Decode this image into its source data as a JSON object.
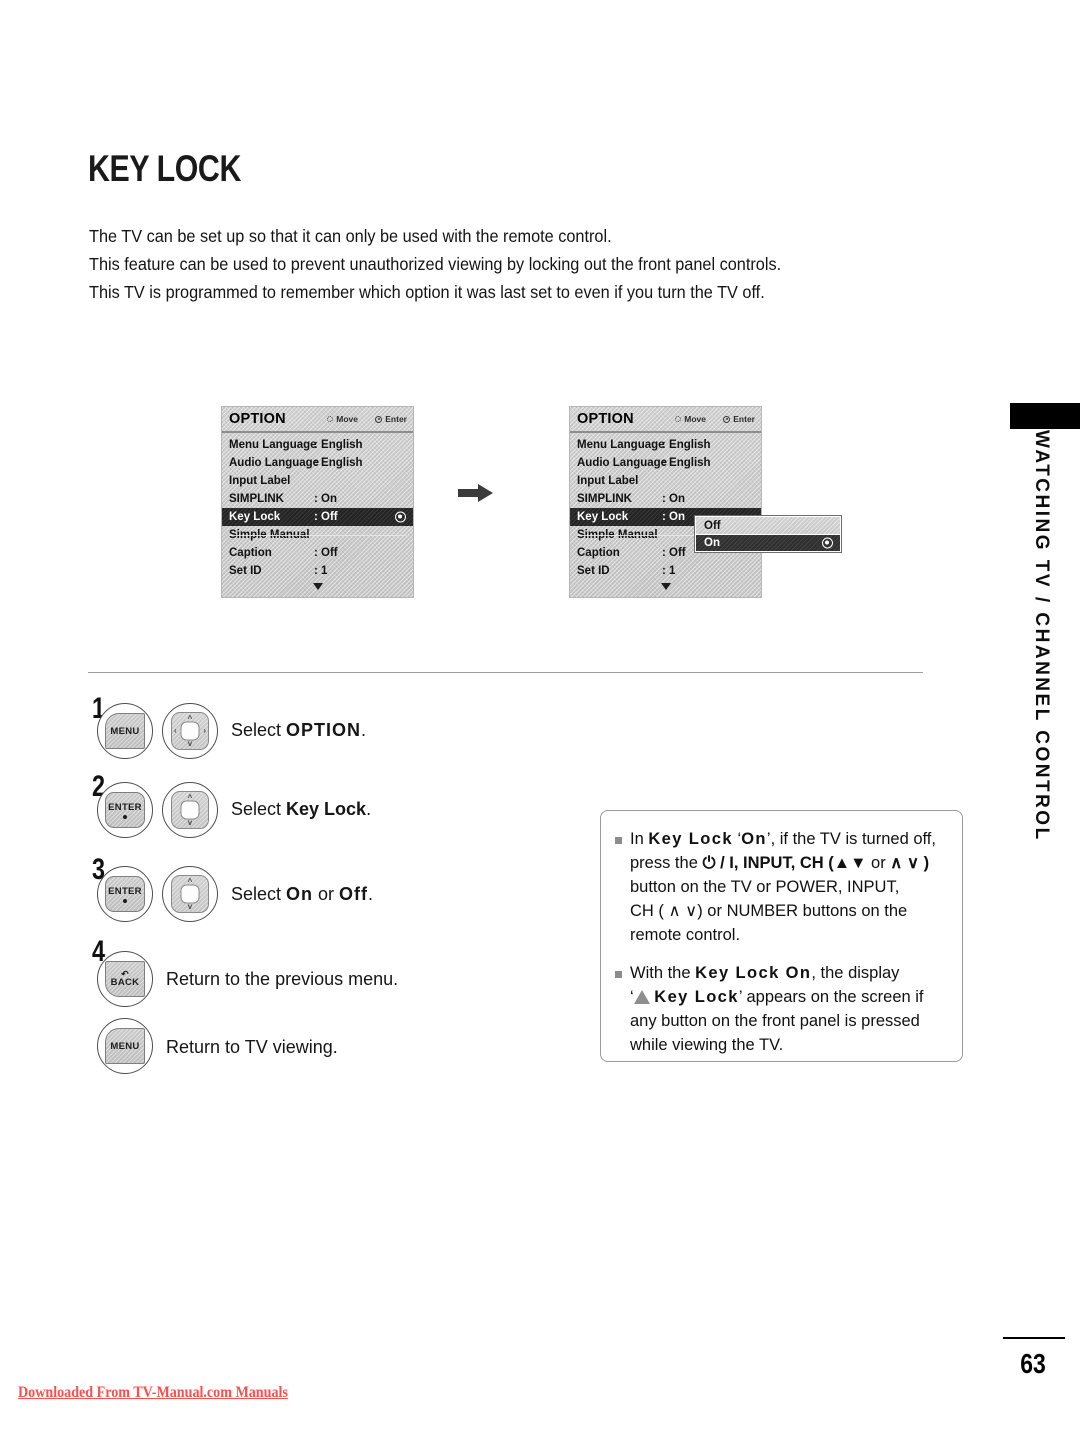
{
  "page_title": "KEY LOCK",
  "intro_lines": [
    "The TV can be set up so that it can only be used with the remote control.",
    "This feature can be used to prevent unauthorized viewing by locking out the front panel controls.",
    "This TV is programmed to remember which option it was last set to even if you turn the TV off."
  ],
  "osd": {
    "title": "OPTION",
    "hint_move": "Move",
    "hint_enter": "Enter",
    "rows_before": [
      {
        "label": "Menu Language",
        "value": ": English"
      },
      {
        "label": "Audio Language",
        "value": ": English"
      },
      {
        "label": "Input Label",
        "value": ""
      },
      {
        "label": "SIMPLINK",
        "value": ": On"
      },
      {
        "label": "Key Lock",
        "value": ": Off"
      },
      {
        "label": "Simple Manual",
        "value": ""
      },
      {
        "label": "Caption",
        "value": ": Off"
      },
      {
        "label": "Set ID",
        "value": ": 1"
      }
    ],
    "rows_after": [
      {
        "label": "Menu Language",
        "value": ": English"
      },
      {
        "label": "Audio Language",
        "value": ": English"
      },
      {
        "label": "Input Label",
        "value": ""
      },
      {
        "label": "SIMPLINK",
        "value": ": On"
      },
      {
        "label": "Key Lock",
        "value": ": On"
      },
      {
        "label": "Simple Manual",
        "value": ""
      },
      {
        "label": "Caption",
        "value": ": Off"
      },
      {
        "label": "Set ID",
        "value": ": 1"
      }
    ],
    "dropdown": {
      "option_off": "Off",
      "option_on": "On",
      "selected": "On"
    }
  },
  "steps": [
    {
      "number": "1",
      "button_label": "MENU",
      "text_prefix": "Select ",
      "text_bold": "OPTION",
      "text_suffix": "."
    },
    {
      "number": "2",
      "button_label": "ENTER",
      "text_prefix": "Select ",
      "text_bold": "Key Lock",
      "text_suffix": "."
    },
    {
      "number": "3",
      "button_label": "ENTER",
      "text_prefix": "Select ",
      "text_bold": "On",
      "text_mid": " or ",
      "text_bold2": "Off",
      "text_suffix": "."
    },
    {
      "number": "4",
      "button_label": "BACK",
      "text": "Return to the previous menu."
    },
    {
      "number": "",
      "button_label": "MENU",
      "text": "Return to TV viewing."
    }
  ],
  "notes": [
    {
      "l1_a": "In ",
      "l1_b": "Key Lock",
      "l1_c": " ‘",
      "l1_d": "On",
      "l1_e": "’, if the TV is turned off,",
      "l2_a": "press the ",
      "l2_b": "⏻ / I, INPUT, CH (▲▼",
      "l2_c": " or ",
      "l2_d": "∧ ∨ )",
      "l3": "button on the TV or POWER, INPUT,",
      "l4": "CH ( ∧ ∨) or NUMBER buttons on the",
      "l5": "remote control."
    },
    {
      "l1_a": "With the ",
      "l1_b": "Key Lock On",
      "l1_c": ", the display",
      "l2_a": "‘",
      "l2_b": "Key Lock",
      "l2_c": "’ appears on the screen if",
      "l3": "any button on the front panel is pressed",
      "l4": "while viewing the TV."
    }
  ],
  "side_tab": "WATCHING TV / CHANNEL CONTROL",
  "page_number": "63",
  "download_note": "Downloaded From TV-Manual.com Manuals",
  "colors": {
    "accent_red": "#f4524d",
    "osd_selected_bg": "#232323",
    "osd_bg": "#cbcbcb"
  }
}
